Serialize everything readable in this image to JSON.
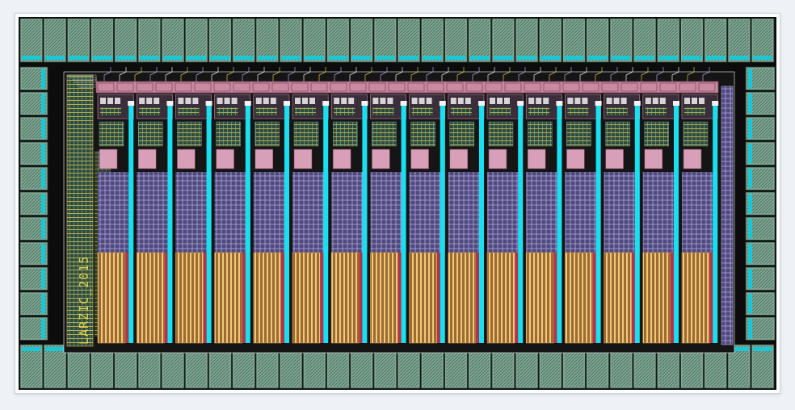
{
  "chip": {
    "label": "LARZIC_2015",
    "colors": {
      "die": "#0c0c0c",
      "pad_fill": "#86a38f",
      "pad_hatch": "#2e6f5f",
      "pad_outline": "#1f3f37",
      "pad_connector": "#19c7d6",
      "bus": "#c98aa1",
      "bus_line": "#7a3f5a",
      "column_cyan": "#18e0f0",
      "mesh_purple": "#b9a3e6",
      "cap_orange": "#d49a52",
      "cap_stripe": "#f0c878",
      "cap_red": "#b5324a",
      "logic_yellow": "#d8c84a",
      "route_white": "#f2f2f2",
      "label_color": "#e6d24a"
    },
    "channels": 16
  }
}
